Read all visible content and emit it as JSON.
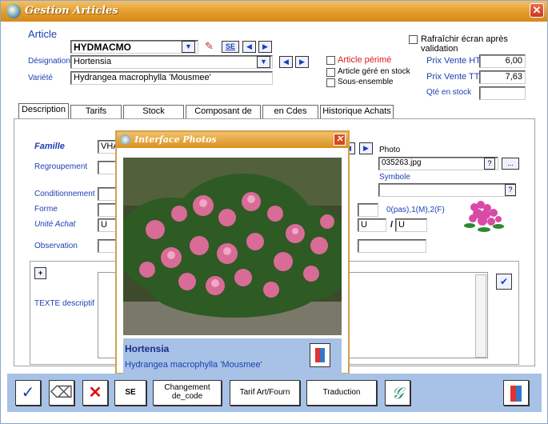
{
  "window": {
    "title": "Gestion Articles"
  },
  "header": {
    "article_label": "Article",
    "article_value": "HYDMACMO",
    "se_label": "SE",
    "designation_label": "Désignation",
    "designation_value": "Hortensia",
    "variete_label": "Variété",
    "variete_value": "Hydrangea macrophylla 'Mousmee'",
    "refresh_label": "Rafraîchir écran après validation",
    "perime_label": "Article périmé",
    "stock_label": "Article géré en stock",
    "sousensemble_label": "Sous-ensemble",
    "prix_ht_label": "Prix Vente HT",
    "prix_ht_value": "6,00",
    "prix_ttc_label": "Prix Vente TTC",
    "prix_ttc_value": "7,63",
    "qte_label": "Qté en stock",
    "qte_value": ""
  },
  "tabs": [
    "Description",
    "Tarifs",
    "Stock",
    "Composant de S/E",
    "en Cdes Client",
    "Historique Achats"
  ],
  "description": {
    "famille_label": "Famille",
    "famille_value": "VHA",
    "regroupement_label": "Regroupement",
    "conditionnement_label": "Conditionnement",
    "forme_label": "Forme",
    "unite_label": "Unité Achat",
    "unite_value": "U",
    "observation_label": "Observation",
    "texte_label": "TEXTE descriptif",
    "photo_label": "Photo",
    "photo_value": "035263.jpg",
    "photo_q": "?",
    "photo_more": "...",
    "symbole_label": "Symbole",
    "symbole_q": "?",
    "pas_label": "0(pas),1(M),2(F)",
    "unit_left": "U",
    "unit_sep": "/",
    "unit_right": "U",
    "plus_label": "+"
  },
  "popup": {
    "title": "Interface Photos",
    "common_name": "Hortensia",
    "latin_name": "Hydrangea macrophylla 'Mousmee'"
  },
  "toolbar": {
    "se_label": "SE",
    "changement_label_1": "Changement",
    "changement_label_2": "de_code",
    "tarif_label": "Tarif Art/Fourn",
    "traduction_label": "Traduction"
  }
}
